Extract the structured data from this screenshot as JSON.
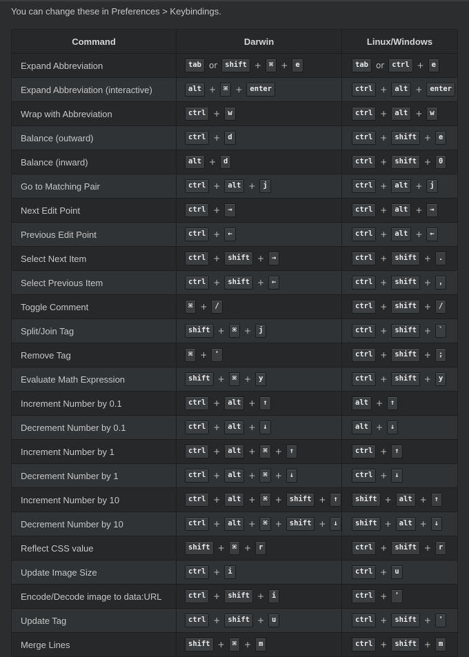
{
  "intro": "You can change these in Preferences > Keybindings.",
  "headers": [
    "Command",
    "Darwin",
    "Linux/Windows"
  ],
  "rows": [
    {
      "command": "Expand Abbreviation",
      "darwin": [
        "tab",
        "or",
        "shift",
        "+",
        "⌘",
        "+",
        "e"
      ],
      "linux": [
        "tab",
        "or",
        "ctrl",
        "+",
        "e"
      ]
    },
    {
      "command": "Expand Abbreviation (interactive)",
      "darwin": [
        "alt",
        "+",
        "⌘",
        "+",
        "enter"
      ],
      "linux": [
        "ctrl",
        "+",
        "alt",
        "+",
        "enter"
      ]
    },
    {
      "command": "Wrap with Abbreviation",
      "darwin": [
        "ctrl",
        "+",
        "w"
      ],
      "linux": [
        "ctrl",
        "+",
        "alt",
        "+",
        "w"
      ]
    },
    {
      "command": "Balance (outward)",
      "darwin": [
        "ctrl",
        "+",
        "d"
      ],
      "linux": [
        "ctrl",
        "+",
        "shift",
        "+",
        "e"
      ]
    },
    {
      "command": "Balance (inward)",
      "darwin": [
        "alt",
        "+",
        "d"
      ],
      "linux": [
        "ctrl",
        "+",
        "shift",
        "+",
        "0"
      ]
    },
    {
      "command": "Go to Matching Pair",
      "darwin": [
        "ctrl",
        "+",
        "alt",
        "+",
        "j"
      ],
      "linux": [
        "ctrl",
        "+",
        "alt",
        "+",
        "j"
      ]
    },
    {
      "command": "Next Edit Point",
      "darwin": [
        "ctrl",
        "+",
        "→"
      ],
      "linux": [
        "ctrl",
        "+",
        "alt",
        "+",
        "→"
      ]
    },
    {
      "command": "Previous Edit Point",
      "darwin": [
        "ctrl",
        "+",
        "←"
      ],
      "linux": [
        "ctrl",
        "+",
        "alt",
        "+",
        "←"
      ]
    },
    {
      "command": "Select Next Item",
      "darwin": [
        "ctrl",
        "+",
        "shift",
        "+",
        "→"
      ],
      "linux": [
        "ctrl",
        "+",
        "shift",
        "+",
        "."
      ]
    },
    {
      "command": "Select Previous Item",
      "darwin": [
        "ctrl",
        "+",
        "shift",
        "+",
        "←"
      ],
      "linux": [
        "ctrl",
        "+",
        "shift",
        "+",
        ","
      ]
    },
    {
      "command": "Toggle Comment",
      "darwin": [
        "⌘",
        "+",
        "/"
      ],
      "linux": [
        "ctrl",
        "+",
        "shift",
        "+",
        "/"
      ]
    },
    {
      "command": "Split/Join Tag",
      "darwin": [
        "shift",
        "+",
        "⌘",
        "+",
        "j"
      ],
      "linux": [
        "ctrl",
        "+",
        "shift",
        "+",
        "`"
      ]
    },
    {
      "command": "Remove Tag",
      "darwin": [
        "⌘",
        "+",
        "'"
      ],
      "linux": [
        "ctrl",
        "+",
        "shift",
        "+",
        ";"
      ]
    },
    {
      "command": "Evaluate Math Expression",
      "darwin": [
        "shift",
        "+",
        "⌘",
        "+",
        "y"
      ],
      "linux": [
        "ctrl",
        "+",
        "shift",
        "+",
        "y"
      ]
    },
    {
      "command": "Increment Number by 0.1",
      "darwin": [
        "ctrl",
        "+",
        "alt",
        "+",
        "↑"
      ],
      "linux": [
        "alt",
        "+",
        "↑"
      ]
    },
    {
      "command": "Decrement Number by 0.1",
      "darwin": [
        "ctrl",
        "+",
        "alt",
        "+",
        "↓"
      ],
      "linux": [
        "alt",
        "+",
        "↓"
      ]
    },
    {
      "command": "Increment Number by 1",
      "darwin": [
        "ctrl",
        "+",
        "alt",
        "+",
        "⌘",
        "+",
        "↑"
      ],
      "linux": [
        "ctrl",
        "+",
        "↑"
      ]
    },
    {
      "command": "Decrement Number by 1",
      "darwin": [
        "ctrl",
        "+",
        "alt",
        "+",
        "⌘",
        "+",
        "↓"
      ],
      "linux": [
        "ctrl",
        "+",
        "↓"
      ]
    },
    {
      "command": "Increment Number by 10",
      "darwin": [
        "ctrl",
        "+",
        "alt",
        "+",
        "⌘",
        "+",
        "shift",
        "+",
        "↑"
      ],
      "linux": [
        "shift",
        "+",
        "alt",
        "+",
        "↑"
      ]
    },
    {
      "command": "Decrement Number by 10",
      "darwin": [
        "ctrl",
        "+",
        "alt",
        "+",
        "⌘",
        "+",
        "shift",
        "+",
        "↓"
      ],
      "linux": [
        "shift",
        "+",
        "alt",
        "+",
        "↓"
      ]
    },
    {
      "command": "Reflect CSS value",
      "darwin": [
        "shift",
        "+",
        "⌘",
        "+",
        "r"
      ],
      "linux": [
        "ctrl",
        "+",
        "shift",
        "+",
        "r"
      ]
    },
    {
      "command": "Update Image Size",
      "darwin": [
        "ctrl",
        "+",
        "i"
      ],
      "linux": [
        "ctrl",
        "+",
        "u"
      ]
    },
    {
      "command": "Encode/Decode image to data:URL",
      "darwin": [
        "ctrl",
        "+",
        "shift",
        "+",
        "i"
      ],
      "linux": [
        "ctrl",
        "+",
        "'"
      ]
    },
    {
      "command": "Update Tag",
      "darwin": [
        "ctrl",
        "+",
        "shift",
        "+",
        "u"
      ],
      "linux": [
        "ctrl",
        "+",
        "shift",
        "+",
        "'"
      ]
    },
    {
      "command": "Merge Lines",
      "darwin": [
        "shift",
        "+",
        "⌘",
        "+",
        "m"
      ],
      "linux": [
        "ctrl",
        "+",
        "shift",
        "+",
        "m"
      ]
    }
  ]
}
